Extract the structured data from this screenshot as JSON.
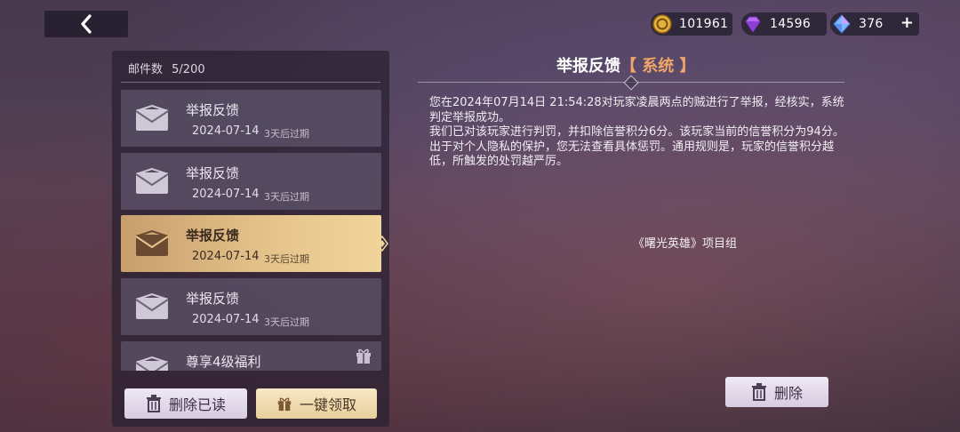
{
  "currency": {
    "gold": "101961",
    "purple_gem": "14596",
    "blue_gem": "376",
    "add_symbol": "+"
  },
  "mail_panel": {
    "count_label": "邮件数",
    "count_value": "5/200",
    "items": [
      {
        "title": "举报反馈",
        "date": "2024-07-14",
        "expire": "3天后过期"
      },
      {
        "title": "举报反馈",
        "date": "2024-07-14",
        "expire": "3天后过期"
      },
      {
        "title": "举报反馈",
        "date": "2024-07-14",
        "expire": "3天后过期",
        "selected": true
      },
      {
        "title": "举报反馈",
        "date": "2024-07-14",
        "expire": "3天后过期"
      },
      {
        "title": "尊享4级福利",
        "date": "",
        "expire": ""
      }
    ],
    "delete_read_label": "删除已读",
    "claim_all_label": "一键领取"
  },
  "detail": {
    "title": "举报反馈",
    "tag": "【 系统 】",
    "paragraphs": [
      "您在2024年07月14日 21:54:28对玩家凌晨两点的贼进行了举报，经核实，系统判定举报成功。",
      "我们已对该玩家进行判罚，并扣除信誉积分6分。该玩家当前的信誉积分为94分。",
      "出于对个人隐私的保护，您无法查看具体惩罚。通用规则是，玩家的信誉积分越低，所触发的处罚越严厉。"
    ],
    "signature": "《曙光英雄》项目组",
    "delete_label": "删除"
  },
  "icons": {
    "back": "chevron-left-icon",
    "gold": "gold-coin-icon",
    "purple": "purple-diamond-icon",
    "blue": "blue-diamond-icon",
    "mail": "envelope-icon",
    "gift": "gift-icon",
    "trash": "trash-icon"
  }
}
